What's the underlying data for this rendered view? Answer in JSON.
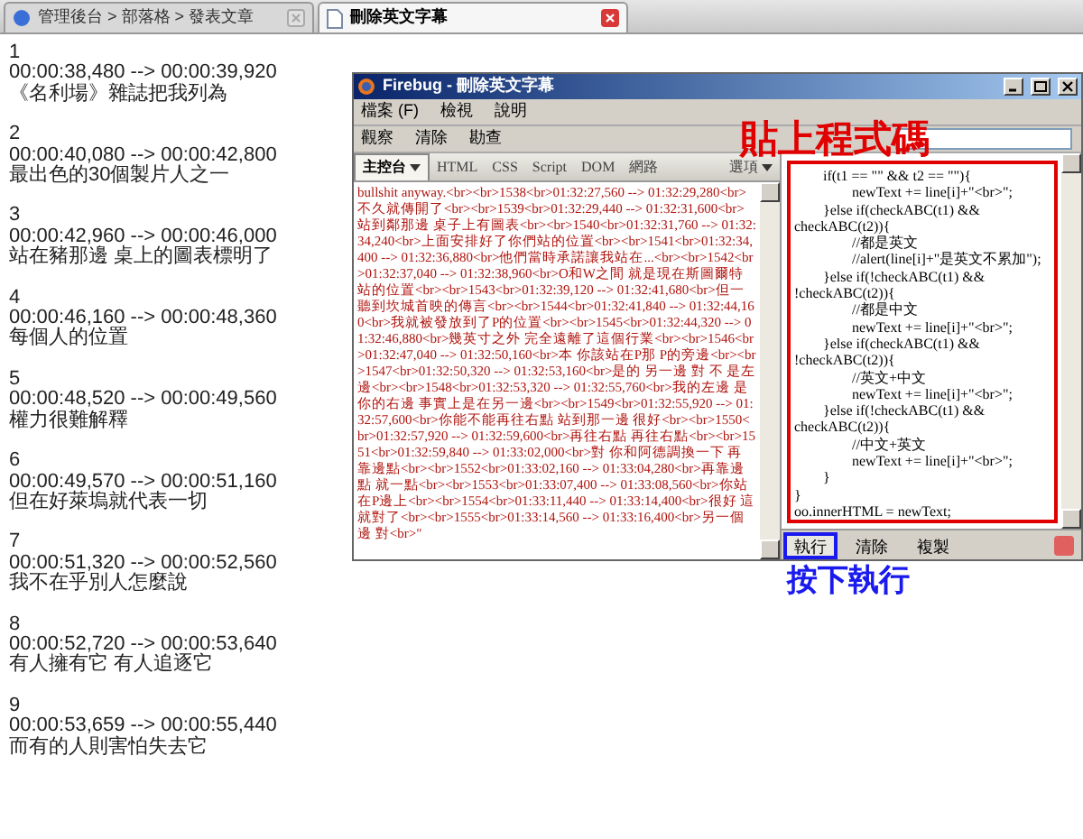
{
  "browser_tabs": [
    {
      "label": "管理後台 > 部落格 > 發表文章",
      "selected": false
    },
    {
      "label": "刪除英文字幕",
      "selected": true
    }
  ],
  "subtitles": [
    {
      "index": "1",
      "time": "00:00:38,480 --> 00:00:39,920",
      "text": "《名利場》雜誌把我列為"
    },
    {
      "index": "2",
      "time": "00:00:40,080 --> 00:00:42,800",
      "text": "最出色的30個製片人之一"
    },
    {
      "index": "3",
      "time": "00:00:42,960 --> 00:00:46,000",
      "text": "站在豬那邊 桌上的圖表標明了"
    },
    {
      "index": "4",
      "time": "00:00:46,160 --> 00:00:48,360",
      "text": "每個人的位置"
    },
    {
      "index": "5",
      "time": "00:00:48,520 --> 00:00:49,560",
      "text": "權力很難解釋"
    },
    {
      "index": "6",
      "time": "00:00:49,570 --> 00:00:51,160",
      "text": "但在好萊塢就代表一切"
    },
    {
      "index": "7",
      "time": "00:00:51,320 --> 00:00:52,560",
      "text": "我不在乎別人怎麼說"
    },
    {
      "index": "8",
      "time": "00:00:52,720 --> 00:00:53,640",
      "text": "有人擁有它 有人追逐它"
    },
    {
      "index": "9",
      "time": "00:00:53,659 --> 00:00:55,440",
      "text": "而有的人則害怕失去它"
    }
  ],
  "firebug": {
    "title": "Firebug - 刪除英文字幕",
    "menu": [
      "檔案 (F)",
      "檢視",
      "說明"
    ],
    "toolbar": [
      "觀察",
      "清除",
      "勘查"
    ],
    "tabs": [
      {
        "label": "主控台",
        "selected": true,
        "dropdown": true
      },
      {
        "label": "HTML",
        "selected": false,
        "dropdown": false
      },
      {
        "label": "CSS",
        "selected": false,
        "dropdown": false
      },
      {
        "label": "Script",
        "selected": false,
        "dropdown": false
      },
      {
        "label": "DOM",
        "selected": false,
        "dropdown": false
      },
      {
        "label": "網路",
        "selected": false,
        "dropdown": false
      },
      {
        "label": "選項",
        "selected": false,
        "dropdown": true
      }
    ],
    "console_output": "bullshit anyway.<br><br>1538<br>01:32:27,560 --> 01:32:29,280<br>不久就傳開了<br><br>1539<br>01:32:29,440 --> 01:32:31,600<br>站到鄰那邊 桌子上有圖表<br><br>1540<br>01:32:31,760 --> 01:32:34,240<br>上面安排好了你們站的位置<br><br>1541<br>01:32:34,400 --> 01:32:36,880<br>他們當時承諾讓我站在...<br><br>1542<br>01:32:37,040 --> 01:32:38,960<br>O和W之間 就是現在斯圖爾特站的位置<br><br>1543<br>01:32:39,120 --> 01:32:41,680<br>但一聽到坎城首映的傳言<br><br>1544<br>01:32:41,840 --> 01:32:44,160<br>我就被發放到了P的位置<br><br>1545<br>01:32:44,320 --> 01:32:46,880<br>幾英寸之外 完全遠離了這個行業<br><br>1546<br>01:32:47,040 --> 01:32:50,160<br>本 你該站在P那 P的旁邊<br><br>1547<br>01:32:50,320 --> 01:32:53,160<br>是的 另一邊 對 不 是左邊<br><br>1548<br>01:32:53,320 --> 01:32:55,760<br>我的左邊 是你的右邊 事實上是在另一邊<br><br>1549<br>01:32:55,920 --> 01:32:57,600<br>你能不能再往右點 站到那一邊 很好<br><br>1550<br>01:32:57,920 --> 01:32:59,600<br>再往右點 再往右點<br><br>1551<br>01:32:59,840 --> 01:33:02,000<br>對 你和阿德調換一下 再靠邊點<br><br>1552<br>01:33:02,160 --> 01:33:04,280<br>再靠邊點 就一點<br><br>1553<br>01:33:07,400 --> 01:33:08,560<br>你站在P邊上<br><br>1554<br>01:33:11,440 --> 01:33:14,400<br>很好 這就對了<br><br>1555<br>01:33:14,560 --> 01:33:16,400<br>另一個邊 對<br>\"",
    "code_lines": [
      "\tif(t1 == \"\" && t2 == \"\"){",
      "\t\tnewText += line[i]+\"<br>\";",
      "\t}else if(checkABC(t1) &&",
      "checkABC(t2)){",
      "\t\t//都是英文",
      "\t\t//alert(line[i]+\"是英文不累加\");",
      "\t}else if(!checkABC(t1) &&",
      "!checkABC(t2)){",
      "\t\t//都是中文",
      "\t\tnewText += line[i]+\"<br>\";",
      "\t}else if(checkABC(t1) &&",
      "!checkABC(t2)){",
      "\t\t//英文+中文",
      "\t\tnewText += line[i]+\"<br>\";",
      "\t}else if(!checkABC(t1) &&",
      "checkABC(t2)){",
      "\t\t//中文+英文",
      "\t\tnewText += line[i]+\"<br>\";",
      "\t}",
      "}",
      "oo.innerHTML = newText;"
    ],
    "buttons": [
      {
        "label": "執行",
        "highlighted": true
      },
      {
        "label": "清除",
        "highlighted": false
      },
      {
        "label": "複製",
        "highlighted": false
      }
    ]
  },
  "annotations": [
    {
      "text": "貼上程式碼",
      "color": "#e00000"
    },
    {
      "text": "按下執行",
      "color": "#1a1aee"
    }
  ]
}
